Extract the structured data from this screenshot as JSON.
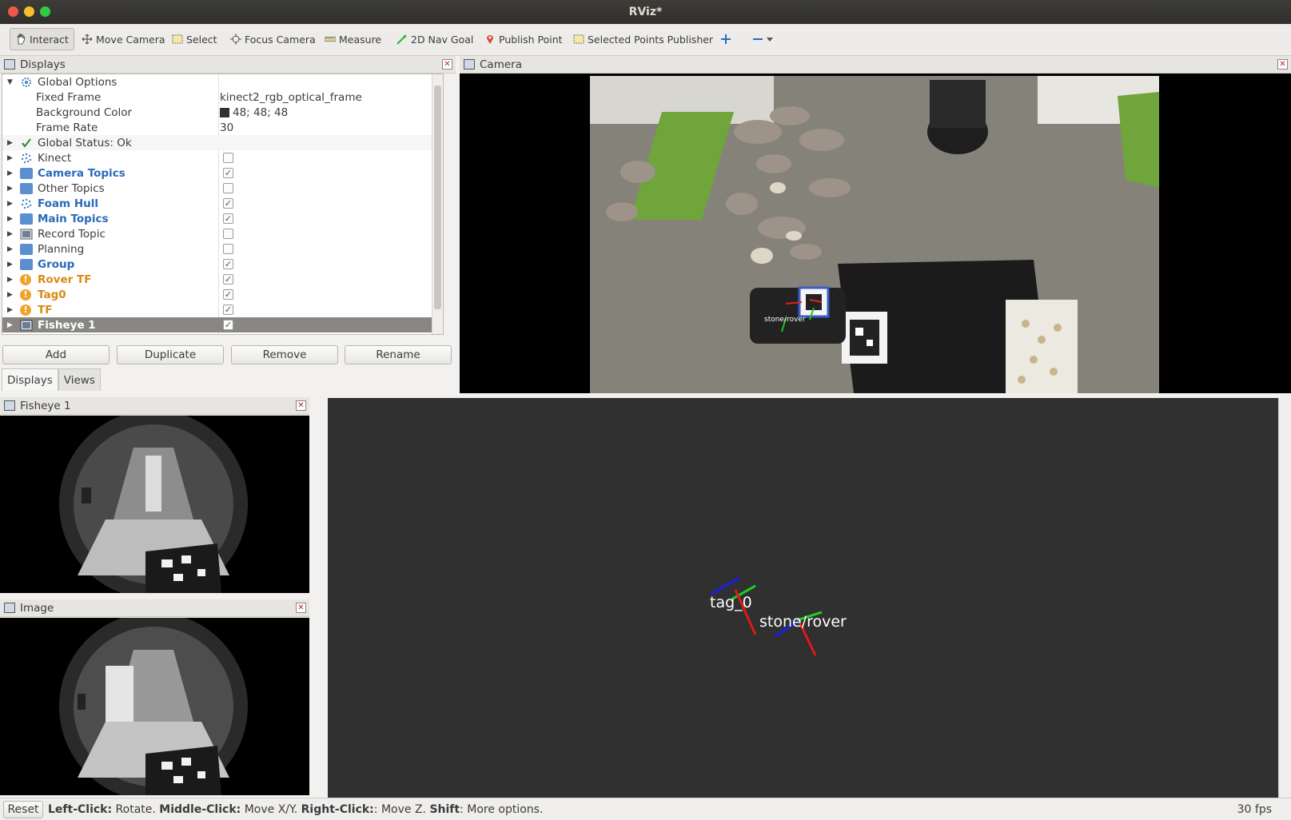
{
  "window": {
    "title": "RViz*"
  },
  "toolbar": {
    "tools": [
      {
        "label": "Interact",
        "icon": "hand-icon"
      },
      {
        "label": "Move Camera",
        "icon": "move-camera-icon"
      },
      {
        "label": "Select",
        "icon": "select-icon"
      },
      {
        "label": "Focus Camera",
        "icon": "focus-camera-icon"
      },
      {
        "label": "Measure",
        "icon": "ruler-icon"
      },
      {
        "label": "2D Nav Goal",
        "icon": "nav-goal-arrow-icon"
      },
      {
        "label": "Publish Point",
        "icon": "map-pin-icon"
      },
      {
        "label": "Selected Points Publisher",
        "icon": "selected-points-icon"
      }
    ]
  },
  "displays": {
    "title": "Displays",
    "global_options": {
      "label": "Global Options",
      "fixed_frame_label": "Fixed Frame",
      "fixed_frame_value": "kinect2_rgb_optical_frame",
      "bg_color_label": "Background Color",
      "bg_color_value": "48; 48; 48",
      "frame_rate_label": "Frame Rate",
      "frame_rate_value": "30"
    },
    "global_status": "Global Status: Ok",
    "items": [
      {
        "label": "Kinect",
        "checked": false
      },
      {
        "label": "Camera Topics",
        "checked": true
      },
      {
        "label": "Other Topics",
        "checked": false
      },
      {
        "label": "Foam Hull",
        "checked": true
      },
      {
        "label": "Main Topics",
        "checked": true
      },
      {
        "label": "Record Topic",
        "checked": false
      },
      {
        "label": "Planning",
        "checked": false
      },
      {
        "label": "Group",
        "checked": true
      },
      {
        "label": "Rover TF",
        "checked": true
      },
      {
        "label": "Tag0",
        "checked": true
      },
      {
        "label": "TF",
        "checked": true
      },
      {
        "label": "Fisheye 1",
        "checked": true
      }
    ],
    "buttons": {
      "add": "Add",
      "duplicate": "Duplicate",
      "remove": "Remove",
      "rename": "Rename"
    },
    "tabs": {
      "displays": "Displays",
      "views": "Views"
    }
  },
  "camera": {
    "title": "Camera",
    "overlay_label": "stone/rover"
  },
  "fisheye": {
    "title": "Fisheye 1"
  },
  "image": {
    "title": "Image"
  },
  "view3d": {
    "tag_label": "tag_0",
    "rover_label": "stone/rover"
  },
  "status": {
    "reset": "Reset",
    "left_click": "Left-Click:",
    "left_action": " Rotate. ",
    "middle_click": "Middle-Click:",
    "middle_action": " Move X/Y. ",
    "right_click": "Right-Click:",
    "right_action": ": Move Z. ",
    "shift": "Shift",
    "shift_action": ": More options.",
    "fps": "30 fps"
  }
}
